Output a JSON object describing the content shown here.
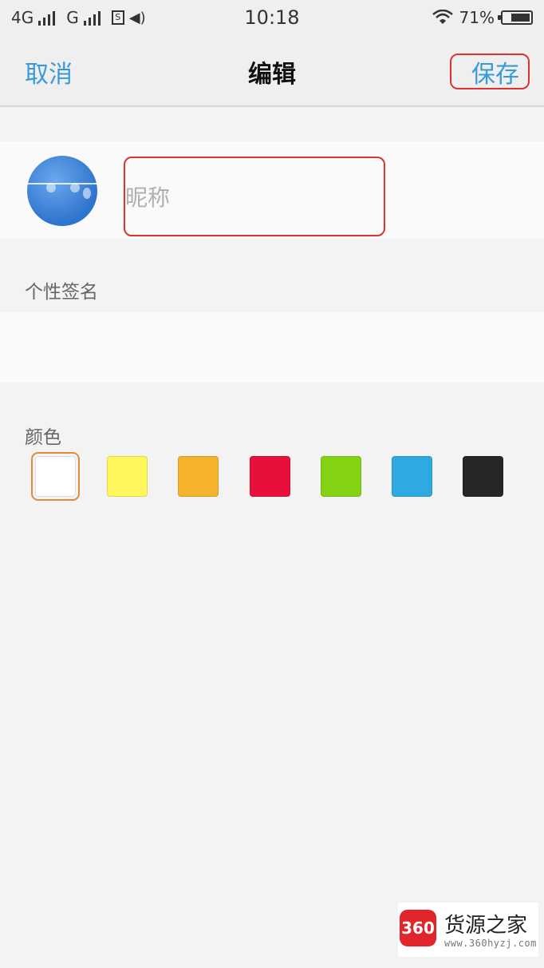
{
  "status_bar": {
    "network1": "4G",
    "network2": "G",
    "time": "10:18",
    "battery_percent": "71%",
    "battery_level": 0.71
  },
  "nav": {
    "cancel_label": "取消",
    "title": "编辑",
    "save_label": "保存"
  },
  "profile": {
    "nickname_placeholder": "昵称",
    "nickname_value": ""
  },
  "signature": {
    "label": "个性签名",
    "value": ""
  },
  "colors": {
    "label": "颜色",
    "options": [
      {
        "name": "white",
        "hex": "#ffffff",
        "selected": true
      },
      {
        "name": "yellow",
        "hex": "#fff75b",
        "selected": false
      },
      {
        "name": "orange",
        "hex": "#f5b22b",
        "selected": false
      },
      {
        "name": "red",
        "hex": "#e8103a",
        "selected": false
      },
      {
        "name": "green",
        "hex": "#84d214",
        "selected": false
      },
      {
        "name": "blue",
        "hex": "#2fa9e0",
        "selected": false
      },
      {
        "name": "black",
        "hex": "#262626",
        "selected": false
      }
    ]
  },
  "watermark": {
    "badge": "360",
    "name": "货源之家",
    "url": "www.360hyzj.com"
  }
}
